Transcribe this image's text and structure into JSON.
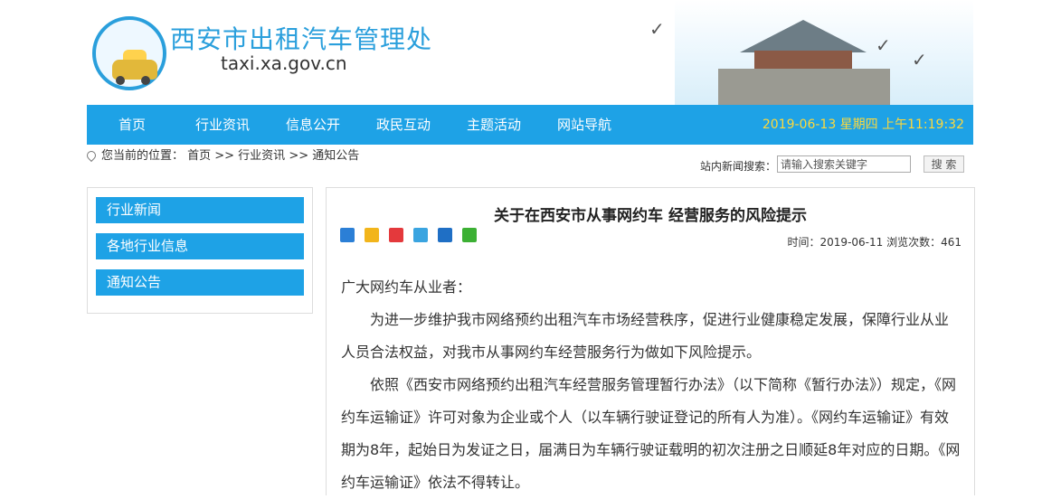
{
  "header": {
    "site_title": "西安市出租汽车管理处",
    "site_url": "taxi.xa.gov.cn"
  },
  "nav": {
    "items": [
      "首页",
      "行业资讯",
      "信息公开",
      "政民互动",
      "主题活动",
      "网站导航"
    ],
    "datetime": "2019-06-13 星期四 上午11:19:32"
  },
  "breadcrumb": {
    "text": "您当前的位置： 首页 >> 行业资讯 >> 通知公告"
  },
  "search": {
    "label": "站内新闻搜索：",
    "placeholder": "请输入搜索关键字",
    "button": "搜 索"
  },
  "sidebar": {
    "items": [
      "行业新闻",
      "各地行业信息",
      "通知公告"
    ]
  },
  "article": {
    "title": "关于在西安市从事网约车 经营服务的风险提示",
    "meta": "时间：2019-06-11 浏览次数：461",
    "share_icons": [
      "add-share-icon",
      "favorite-share-icon",
      "weibo-share-icon",
      "qzone-share-icon",
      "renren-share-icon",
      "wechat-share-icon"
    ],
    "greeting": "广大网约车从业者：",
    "paragraphs": [
      "为进一步维护我市网络预约出租汽车市场经营秩序，促进行业健康稳定发展，保障行业从业人员合法权益，对我市从事网约车经营服务行为做如下风险提示。",
      " 依照《西安市网络预约出租汽车经营服务管理暂行办法》（以下简称《暂行办法》）规定，《网约车运输证》许可对象为企业或个人（以车辆行驶证登记的所有人为准）。《网约车运输证》有效期为8年，起始日为发证之日，届满日为车辆行驶证载明的初次注册之日顺延8年对应的日期。《网约车运输证》依法不得转让。"
    ]
  },
  "colors": {
    "nav_bg": "#1ea2e6",
    "date_text": "#ffd93a",
    "title_blue": "#2a9fdc"
  }
}
